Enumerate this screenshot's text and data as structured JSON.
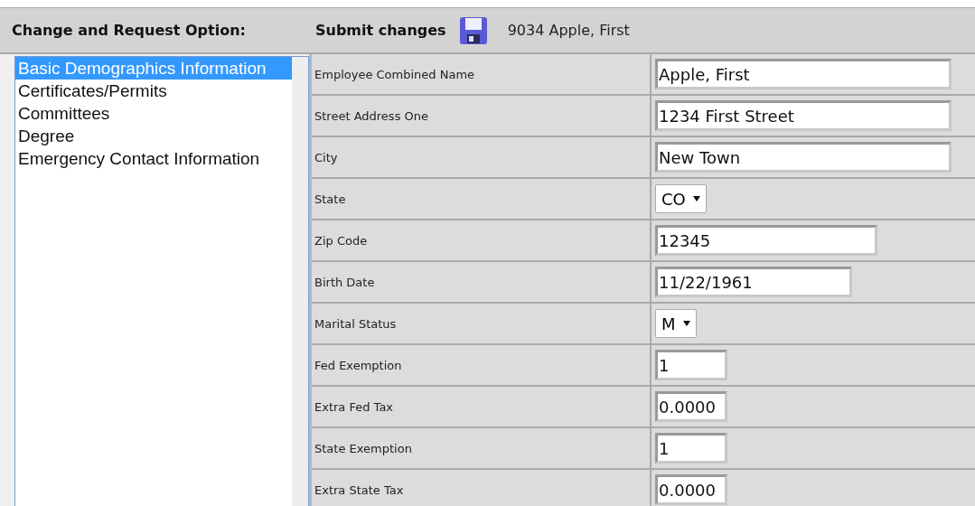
{
  "header": {
    "option_label": "Change and Request Option:",
    "submit_label": "Submit changes",
    "employee": "9034  Apple, First"
  },
  "options": [
    {
      "label": "Basic Demographics Information",
      "selected": true
    },
    {
      "label": "Certificates/Permits",
      "selected": false
    },
    {
      "label": "Committees",
      "selected": false
    },
    {
      "label": "Degree",
      "selected": false
    },
    {
      "label": "Emergency Contact Information",
      "selected": false
    }
  ],
  "fields": [
    {
      "label": "Employee Combined Name",
      "kind": "long-text",
      "value": "Apple, First"
    },
    {
      "label": "Street Address One",
      "kind": "long-text",
      "value": "1234 First Street"
    },
    {
      "label": "City",
      "kind": "long-text",
      "value": "New Town"
    },
    {
      "label": "State",
      "kind": "select",
      "value": "CO"
    },
    {
      "label": "Zip Code",
      "kind": "medium-text",
      "value": "12345"
    },
    {
      "label": "Birth Date",
      "kind": "date-text",
      "value": "11/22/1961"
    },
    {
      "label": "Marital Status",
      "kind": "select",
      "value": "M"
    },
    {
      "label": "Fed Exemption",
      "kind": "short-text",
      "value": "1"
    },
    {
      "label": "Extra Fed Tax",
      "kind": "short-text",
      "value": "0.0000"
    },
    {
      "label": "State Exemption",
      "kind": "short-text",
      "value": "1"
    },
    {
      "label": "Extra State Tax",
      "kind": "short-text",
      "value": "0.0000"
    }
  ]
}
